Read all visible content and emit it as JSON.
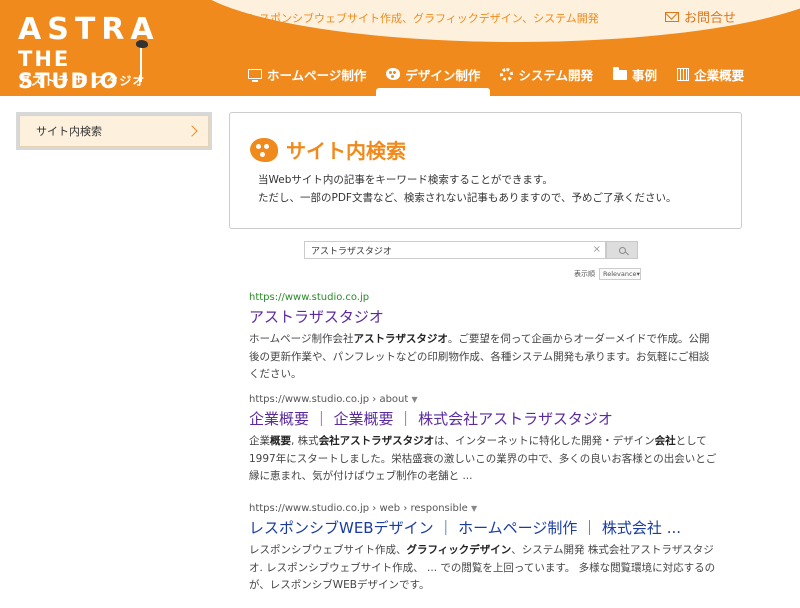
{
  "header": {
    "tagline": "レスポンシブウェブサイト作成、グラフィックデザイン、システム開発",
    "contact_label": "お問合せ",
    "logo": {
      "line1": "ASTRA",
      "line2": "THE STUDIO",
      "kana": "アストラ ザ スタジオ"
    }
  },
  "nav": [
    {
      "label": "ホームページ制作",
      "icon": "monitor-icon"
    },
    {
      "label": "デザイン制作",
      "icon": "palette-icon"
    },
    {
      "label": "システム開発",
      "icon": "gear-icon"
    },
    {
      "label": "事例",
      "icon": "folder-icon"
    },
    {
      "label": "企業概要",
      "icon": "building-icon"
    }
  ],
  "sidebar": {
    "items": [
      {
        "label": "サイト内検索"
      }
    ]
  },
  "main": {
    "title": "サイト内検索",
    "desc1": "当Webサイト内の記事をキーワード検索することができます。",
    "desc2": "ただし、一部のPDF文書など、検索されない記事もありますので、予めご了承ください。"
  },
  "search": {
    "query": "アストラザスタジオ",
    "clear": "×",
    "sort_label": "表示順",
    "sort_value": "Relevance"
  },
  "results": [
    {
      "url": "https://www.studio.co.jp",
      "title": "アストラザスタジオ",
      "snippet": "ホームページ制作会社<b>アストラザスタジオ</b>。ご要望を伺って企画からオーダーメイドで作成。公開後の更新作業や、パンフレットなどの印刷物作成、各種システム開発も承ります。お気軽にご相談ください。"
    },
    {
      "url": "https://www.studio.co.jp › about",
      "title": "企業概要 ｜ 企業概要 ｜ 株式会社アストラザスタジオ",
      "snippet": "企業<b>概要</b>, 株式<b>会社アストラザスタジオ</b>は、インターネットに特化した開発・デザイン<b>会社</b>として1997年にスタートしました。栄枯盛衰の激しいこの業界の中で、多くの良いお客様との出会いとご縁に恵まれ、気が付けばウェブ制作の老舗と ..."
    },
    {
      "url": "https://www.studio.co.jp › web › responsible",
      "title": "レスポンシブWEBデザイン ｜ ホームページ制作 ｜ 株式会社 ...",
      "snippet": "レスポンシブウェブサイト作成、<b>グラフィックデザイン</b>、システム開発 株式会社アストラザスタジオ. レスポンシブウェブサイト作成、 ... での閲覧を上回っています。 多様な閲覧環境に対応するのが、レスポンシブWEBデザインです。"
    }
  ],
  "colors": {
    "brand_orange": "#f08a1c",
    "banner_cream": "#fdf1de",
    "link_purple": "#5b2aa0",
    "link_blue": "#1a3ca0",
    "url_green": "#2a8a2a"
  }
}
